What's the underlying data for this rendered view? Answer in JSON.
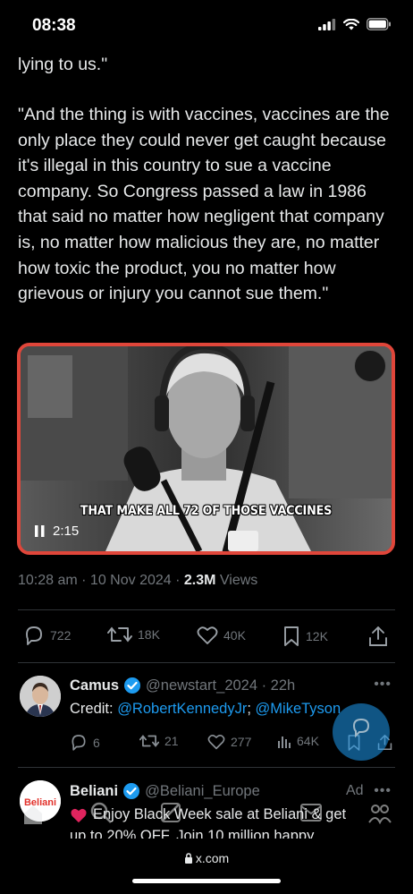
{
  "status_bar": {
    "time": "08:38"
  },
  "tweet": {
    "text_line_1": "lying to us.\"",
    "text_paragraph": "\"And the thing is with vaccines, vaccines are the only place they could never get caught because it's illegal in this country to sue a vaccine company. So Congress passed a law in 1986 that said no matter how negligent that company is, no matter how malicious they are, no matter how toxic the product, you no matter how grievous or injury you cannot sue them.\"",
    "video": {
      "subtitle": "THAT MAKE ALL 72 OF THOSE VACCINES",
      "time": "2:15",
      "watermark_icon": "channel-logo"
    },
    "meta": {
      "timestamp": "10:28 am · 10 Nov 2024 · ",
      "views_count": "2.3M",
      "views_label": " Views"
    },
    "actions": {
      "replies": "722",
      "reposts": "18K",
      "likes": "40K",
      "bookmarks": "12K"
    }
  },
  "replies": [
    {
      "name": "Camus",
      "handle": "@newstart_2024 · 22h",
      "text_prefix": "Credit: ",
      "mention_1": "@RobertKennedyJr",
      "separator": "; ",
      "mention_2": "@MikeTyson",
      "actions": {
        "replies": "6",
        "reposts": "21",
        "likes": "277",
        "views": "64K"
      }
    },
    {
      "name": "Beliani",
      "handle": "@Beliani_Europe",
      "badge": "Ad",
      "avatar_text": "Beliani",
      "text_line_1": "Enjoy Black Week sale at Beliani & get",
      "text_line_2": "up to 20% OFF. Join 10 million happy"
    }
  ],
  "browser": {
    "url": "x.com"
  },
  "colors": {
    "accent": "#1d9bf0",
    "muted": "#71767b",
    "video_border": "#e0463a"
  }
}
